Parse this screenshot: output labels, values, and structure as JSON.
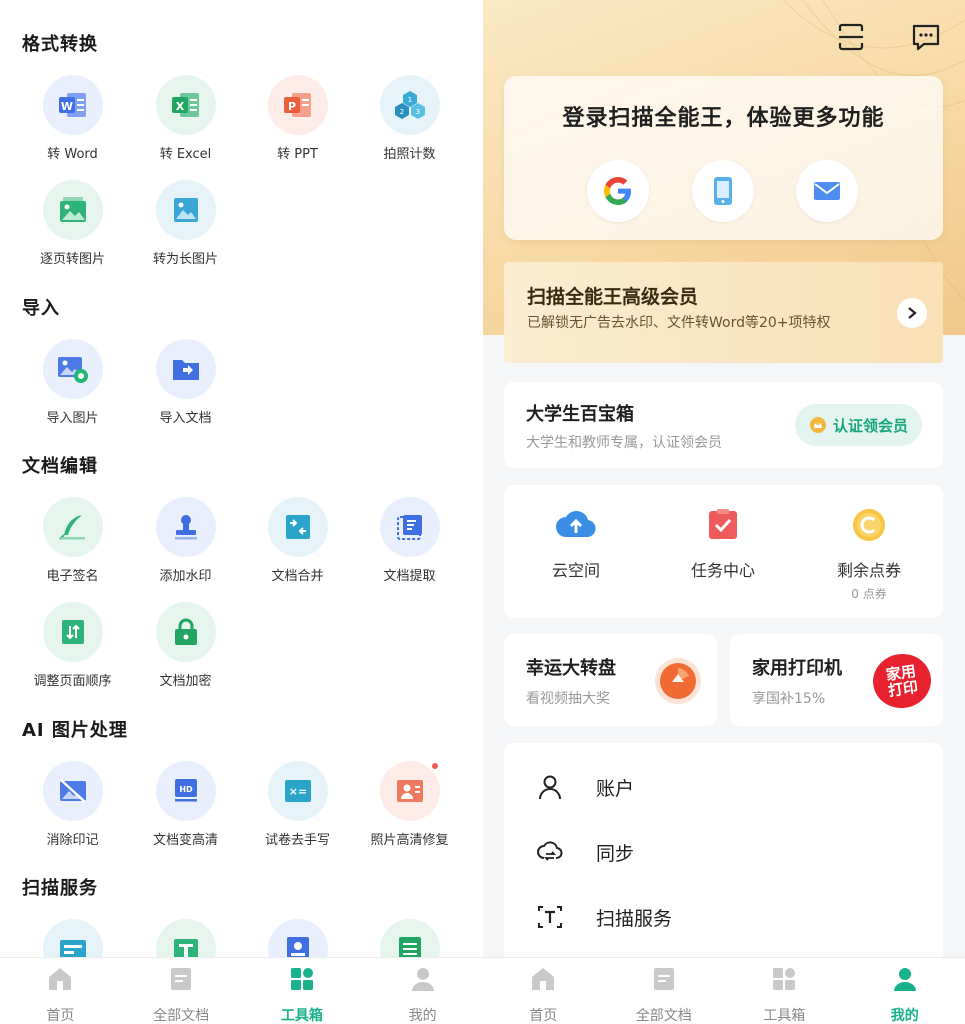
{
  "colors": {
    "accent": "#19b28c",
    "gold": "#f6d7a0",
    "red_dot": "#f25a5a"
  },
  "left": {
    "sections": [
      {
        "title": "格式转换",
        "tools": [
          {
            "label": "转 Word",
            "icon": "word-icon"
          },
          {
            "label": "转 Excel",
            "icon": "excel-icon"
          },
          {
            "label": "转 PPT",
            "icon": "ppt-icon"
          },
          {
            "label": "拍照计数",
            "icon": "photo-count-icon"
          },
          {
            "label": "逐页转图片",
            "icon": "page-to-image-icon"
          },
          {
            "label": "转为长图片",
            "icon": "long-image-icon"
          }
        ]
      },
      {
        "title": "导入",
        "tools": [
          {
            "label": "导入图片",
            "icon": "import-image-icon"
          },
          {
            "label": "导入文档",
            "icon": "import-doc-icon"
          }
        ]
      },
      {
        "title": "文档编辑",
        "tools": [
          {
            "label": "电子签名",
            "icon": "signature-icon"
          },
          {
            "label": "添加水印",
            "icon": "watermark-icon"
          },
          {
            "label": "文档合并",
            "icon": "merge-icon"
          },
          {
            "label": "文档提取",
            "icon": "extract-icon"
          },
          {
            "label": "调整页面顺序",
            "icon": "reorder-icon"
          },
          {
            "label": "文档加密",
            "icon": "lock-icon"
          }
        ]
      },
      {
        "title": "AI 图片处理",
        "tools": [
          {
            "label": "消除印记",
            "icon": "erase-mark-icon"
          },
          {
            "label": "文档变高清",
            "icon": "hd-icon"
          },
          {
            "label": "试卷去手写",
            "icon": "remove-handwriting-icon"
          },
          {
            "label": "照片高清修复",
            "icon": "photo-restore-icon"
          }
        ]
      },
      {
        "title": "扫描服务",
        "tools": [
          {
            "label": "",
            "icon": "id-card-icon"
          },
          {
            "label": "",
            "icon": "text-icon"
          },
          {
            "label": "",
            "icon": "id-photo-icon"
          },
          {
            "label": "",
            "icon": "sheet-icon"
          }
        ]
      }
    ],
    "tabs": [
      {
        "label": "首页",
        "icon": "home-icon"
      },
      {
        "label": "全部文档",
        "icon": "documents-icon"
      },
      {
        "label": "工具箱",
        "icon": "toolbox-icon",
        "active": true
      },
      {
        "label": "我的",
        "icon": "profile-icon"
      }
    ]
  },
  "right": {
    "top_icons": [
      "scan-icon",
      "message-icon"
    ],
    "login": {
      "title": "登录扫描全能王，体验更多功能",
      "methods": [
        "google-icon",
        "phone-icon",
        "email-icon"
      ]
    },
    "vip": {
      "title": "扫描全能王高级会员",
      "subtitle": "已解锁无广告去水印、文件转Word等20+项特权"
    },
    "student": {
      "title": "大学生百宝箱",
      "subtitle": "大学生和教师专属，认证领会员",
      "button": "认证领会员"
    },
    "stats": [
      {
        "label": "云空间",
        "sub": "",
        "icon": "cloud-upload-icon"
      },
      {
        "label": "任务中心",
        "sub": "",
        "icon": "task-icon"
      },
      {
        "label": "剩余点券",
        "sub": "0 点券",
        "icon": "coupon-icon"
      }
    ],
    "promos": [
      {
        "title": "幸运大转盘",
        "subtitle": "看视频抽大奖",
        "icon": "wheel-icon"
      },
      {
        "title": "家用打印机",
        "subtitle": "享国补15%",
        "badge": "家用打印",
        "icon": "printer-badge-icon"
      }
    ],
    "menu": [
      {
        "label": "账户",
        "icon": "user-icon"
      },
      {
        "label": "同步",
        "icon": "sync-icon"
      },
      {
        "label": "扫描服务",
        "icon": "scan-service-icon"
      }
    ],
    "tabs": [
      {
        "label": "首页",
        "icon": "home-icon"
      },
      {
        "label": "全部文档",
        "icon": "documents-icon"
      },
      {
        "label": "工具箱",
        "icon": "toolbox-icon"
      },
      {
        "label": "我的",
        "icon": "profile-icon",
        "active": true
      }
    ]
  }
}
